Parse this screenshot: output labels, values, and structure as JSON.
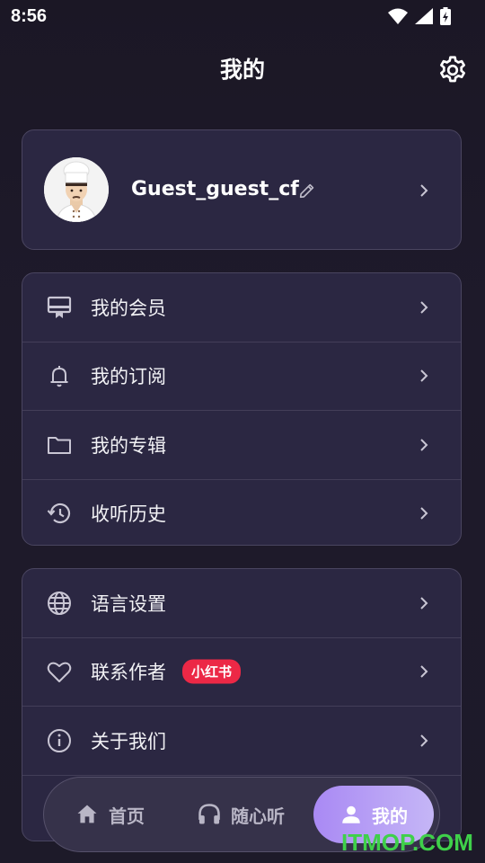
{
  "status_bar": {
    "time": "8:56"
  },
  "header": {
    "title": "我的"
  },
  "profile": {
    "username": "Guest_guest_cf"
  },
  "menu_group_1": [
    {
      "icon": "membership-card-icon",
      "label": "我的会员"
    },
    {
      "icon": "bell-icon",
      "label": "我的订阅"
    },
    {
      "icon": "folder-icon",
      "label": "我的专辑"
    },
    {
      "icon": "history-icon",
      "label": "收听历史"
    }
  ],
  "menu_group_2": [
    {
      "icon": "globe-icon",
      "label": "语言设置"
    },
    {
      "icon": "heart-icon",
      "label": "联系作者",
      "badge": "小红书"
    },
    {
      "icon": "info-icon",
      "label": "关于我们"
    }
  ],
  "bottom_nav": {
    "home_label": "首页",
    "listen_label": "随心听",
    "mine_label": "我的",
    "active": "mine"
  },
  "watermark": "ITMOP.COM",
  "colors": {
    "badge": "#ec2846",
    "active_tab": "#a989f4",
    "card": "#2b2742"
  }
}
